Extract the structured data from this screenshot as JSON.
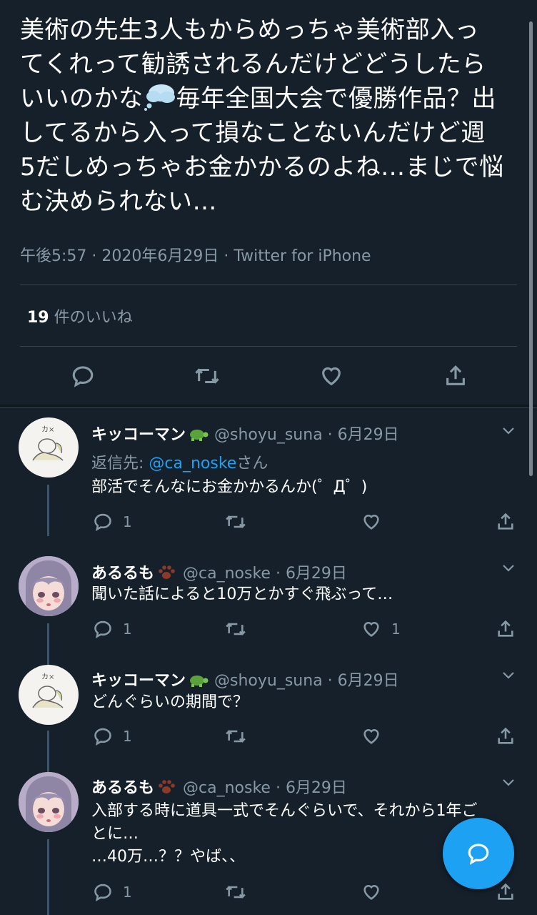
{
  "main_tweet": {
    "text_lines": [
      "美術の先生3人もからめっちゃ美術部入っ",
      "てくれって勧誘されるんだけどどうしたら",
      "いいのかな",
      "毎年全国大会で優勝作品？出",
      "してるから入って損なことないんだけど週",
      "5だしめっちゃお金かかるのよね…まじで悩",
      "む決められない…"
    ],
    "time": "午後5:57",
    "date": "2020年6月29日",
    "source": "Twitter for iPhone",
    "like_count": "19",
    "like_label": " 件のいいね"
  },
  "replies": [
    {
      "name": "キッコーマン",
      "handle": "@shoyu_suna",
      "date": "6月29日",
      "emoji": "turtle-icon",
      "replying_prefix": "返信先: ",
      "replying_handle": "@ca_noske",
      "replying_suffix": "さん",
      "text_lines": [
        "部活でそんなにお金かかるんか(゜Д゜)"
      ],
      "reply_count": "1",
      "like_count": ""
    },
    {
      "name": "あるるも",
      "handle": "@ca_noske",
      "date": "6月29日",
      "emoji": "paw-icon",
      "text_lines": [
        "聞いた話によると10万とかすぐ飛ぶって…"
      ],
      "reply_count": "1",
      "like_count": "1"
    },
    {
      "name": "キッコーマン",
      "handle": "@shoyu_suna",
      "date": "6月29日",
      "emoji": "turtle-icon",
      "text_lines": [
        "どんぐらいの期間で？"
      ],
      "reply_count": "1",
      "like_count": ""
    },
    {
      "name": "あるるも",
      "handle": "@ca_noske",
      "date": "6月29日",
      "emoji": "paw-icon",
      "text_lines": [
        "入部する時に道具一式でそんぐらいで、それから1年ご",
        "とに…",
        "…40万…？？やば、、"
      ],
      "reply_count": "1",
      "like_count": ""
    }
  ],
  "separator": " · ",
  "colors": {
    "background": "#15202b",
    "secondary_text": "#8899a6",
    "accent": "#1da1f2"
  }
}
